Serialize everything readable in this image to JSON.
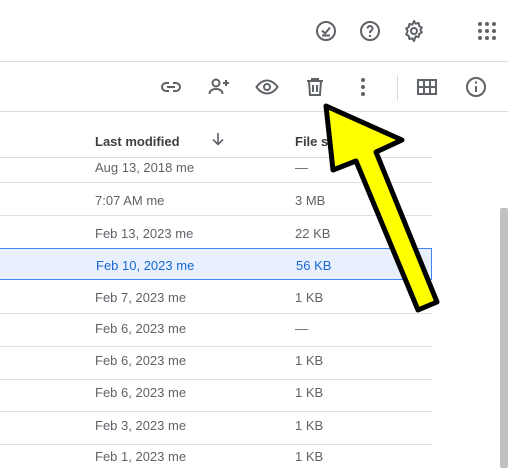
{
  "toolbar_icons": [
    "checkmark-icon",
    "help-icon",
    "settings-icon",
    "apps-icon",
    "link-icon",
    "share-icon",
    "preview-icon",
    "trash-icon",
    "more-vert-icon",
    "grid-view-icon",
    "info-icon"
  ],
  "table": {
    "headers": {
      "last_modified": "Last modified",
      "file_size": "File s"
    },
    "rows": [
      {
        "modified": "Aug 13, 2018",
        "owner": "me",
        "size": "—"
      },
      {
        "modified": "7:07 AM",
        "owner": "me",
        "size": "3 MB"
      },
      {
        "modified": "Feb 13, 2023",
        "owner": "me",
        "size": "22 KB"
      },
      {
        "modified": "Feb 10, 2023",
        "owner": "me",
        "size": "56 KB"
      },
      {
        "modified": "Feb 7, 2023",
        "owner": "me",
        "size": "1 KB"
      },
      {
        "modified": "Feb 6, 2023",
        "owner": "me",
        "size": "—"
      },
      {
        "modified": "Feb 6, 2023",
        "owner": "me",
        "size": "1 KB"
      },
      {
        "modified": "Feb 6, 2023",
        "owner": "me",
        "size": "1 KB"
      },
      {
        "modified": "Feb 3, 2023",
        "owner": "me",
        "size": "1 KB"
      },
      {
        "modified": "Feb 1, 2023",
        "owner": "me",
        "size": "1 KB"
      }
    ]
  },
  "colors": {
    "icon": "#5f6368",
    "selected_bg": "#e8f0fe",
    "selected_border": "#4285f4",
    "selected_text": "#1967d2",
    "arrow_fill": "#ffff00",
    "arrow_stroke": "#000000"
  }
}
